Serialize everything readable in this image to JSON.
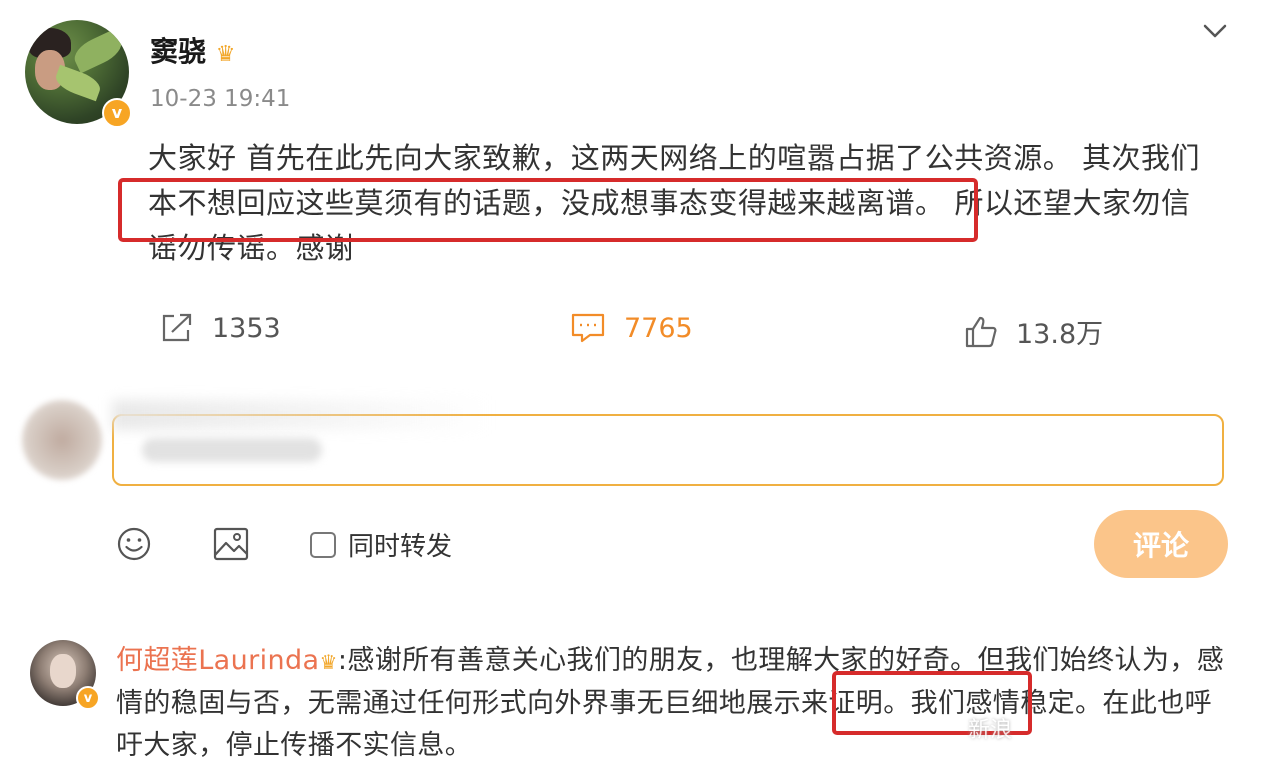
{
  "post": {
    "author": "窦骁",
    "timestamp": "10-23 19:41",
    "text_line1": "大家好 首先在此先向大家致歉，这两天网络上的喧嚣占据了公共资源。 其次我们",
    "text_line2_highlight": "本不想回应这些莫须有的话题，没成想事态变得越来越离谱。",
    "text_line2_rest": "所以还望大家勿信",
    "text_line3": "谣勿传谣。感谢",
    "verified_mark": "v",
    "crown_icon": "crown-icon"
  },
  "actions": {
    "share_count": "1353",
    "comment_count": "7765",
    "like_count": "13.8万"
  },
  "composer": {
    "repost_label": "同时转发",
    "submit_label": "评论"
  },
  "reply": {
    "author": "何超莲Laurinda",
    "separator": ":",
    "text_part1": "感谢所有善意关心我们的朋友，也理解大家的好奇。但我们始终认为，感情的稳固与否，无需通过任何形式向外界事无巨细地展示来证明。",
    "text_highlight": "我们感情稳定。",
    "text_part2": "在此也呼吁大家，停止传播不实信息。"
  },
  "watermark": "新浪",
  "colors": {
    "accent_orange": "#f28c28",
    "highlight_red": "#d62b2b",
    "reply_name": "#eb7350",
    "submit_bg": "#fbc58a"
  }
}
